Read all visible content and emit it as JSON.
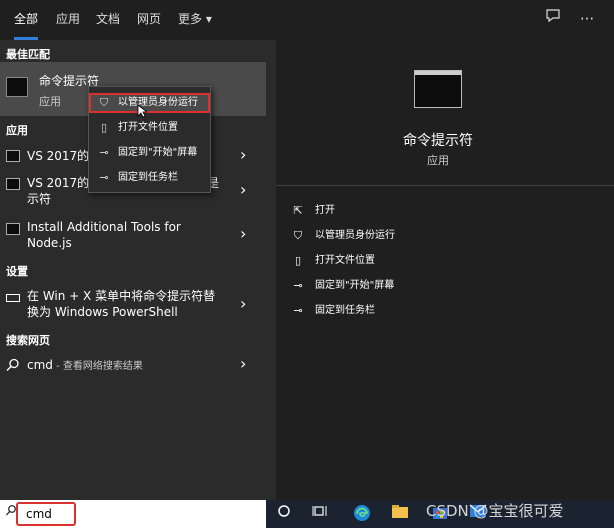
{
  "tabs": [
    "全部",
    "应用",
    "文档",
    "网页",
    "更多"
  ],
  "more_arrow": "▾",
  "sections": {
    "best_match": "最佳匹配",
    "apps": "应用",
    "settings": "设置",
    "web": "搜索网页"
  },
  "best_match": {
    "title": "命令提示符",
    "subtitle": "应用"
  },
  "apps": [
    {
      "label": "VS 2017的开发人员命令提示符"
    },
    {
      "label_l1": "VS 2017的",
      "label_l2": "示符",
      "tail": "是"
    },
    {
      "label_l1": "Install Additional Tools for",
      "label_l2": "Node.js"
    }
  ],
  "apps_first_visible": "VS 2017的",
  "setting_item": {
    "l1": "在 Win + X 菜单中将命令提示符替",
    "l2": "换为 Windows PowerShell"
  },
  "web_item": {
    "query": "cmd",
    "suffix": " - 查看网络搜索结果"
  },
  "context_menu": [
    "以管理员身份运行",
    "打开文件位置",
    "固定到\"开始\"屏幕",
    "固定到任务栏"
  ],
  "right_panel": {
    "title": "命令提示符",
    "subtitle": "应用",
    "actions": [
      "打开",
      "以管理员身份运行",
      "打开文件位置",
      "固定到\"开始\"屏幕",
      "固定到任务栏"
    ]
  },
  "search": {
    "value": "cmd"
  },
  "watermark": "CSDN @宝宝很可爱"
}
